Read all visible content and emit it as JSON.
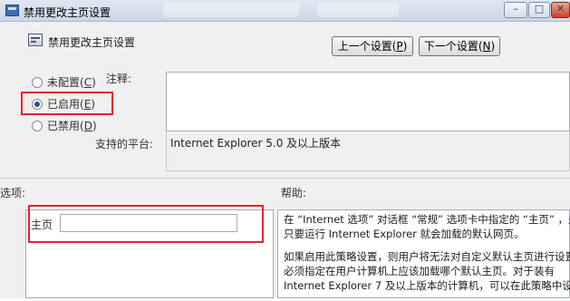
{
  "window": {
    "title": "禁用更改主页设置",
    "controls": {
      "minimize": "–",
      "maximize": "□",
      "close": "✕"
    }
  },
  "header": {
    "icon": "policy-setting-icon",
    "title": "禁用更改主页设置",
    "prev_button": {
      "text": "上一个设置(",
      "key": "P",
      "end": ")"
    },
    "next_button": {
      "text": "下一个设置(",
      "key": "N",
      "end": ")"
    }
  },
  "state": {
    "options": [
      {
        "text": "未配置(",
        "key": "C",
        "end": ")",
        "checked": false
      },
      {
        "text": "已启用(",
        "key": "E",
        "end": ")",
        "checked": true
      },
      {
        "text": "已禁用(",
        "key": "D",
        "end": ")",
        "checked": false
      }
    ]
  },
  "comment": {
    "label": "注释:",
    "value": ""
  },
  "platform": {
    "label": "支持的平台:",
    "value": "Internet Explorer 5.0 及以上版本"
  },
  "options_pane": {
    "label": "选项:",
    "home_label": "主页",
    "home_value": ""
  },
  "help_pane": {
    "label": "帮助:",
    "paragraphs": [
      [
        "在 “Internet 选项” 对话框 “常规” 选项卡中指定的 “主页” ，是",
        "只要运行 Internet Explorer 就会加载的默认网页。"
      ],
      [
        "如果启用此策略设置，则用户将无法对自定义默认主页进行设置。",
        "必须指定在用户计算机上应该加载哪个默认主页。对于装有",
        "Internet Explorer 7 及以上版本的计算机，可以在此策略中设置"
      ]
    ]
  },
  "colors": {
    "highlight": "#e0262a",
    "panel_bg": "#f0f0f0",
    "titlebar": "#c9d7e6"
  }
}
